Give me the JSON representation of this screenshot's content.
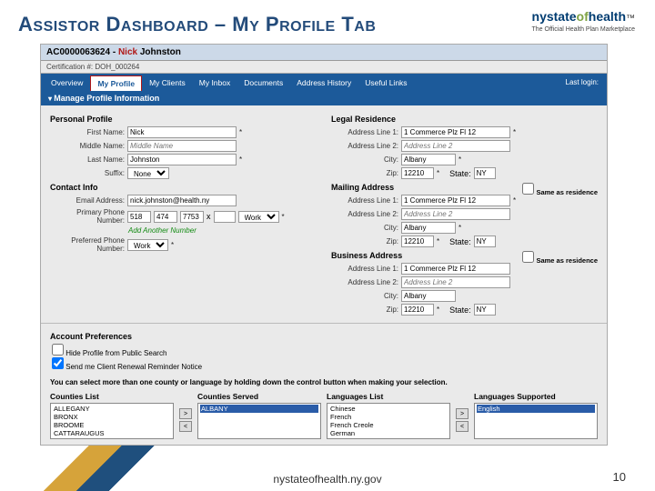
{
  "slide": {
    "title": "ASSISTOR DASHBOARD – MY PROFILE TAB",
    "footer": "nystateofhealth.ny.gov",
    "page": "10"
  },
  "branding": {
    "nys": "nystate",
    "of": "of",
    "health": "health",
    "sub": "The Official Health Plan Marketplace",
    "tm": "™"
  },
  "user": {
    "id": "AC0000063624",
    "sep": " - ",
    "first": "Nick",
    "last": "Johnston"
  },
  "subbar": "Certification #: DOH_000264",
  "tabs": [
    "Overview",
    "My Profile",
    "My Clients",
    "My Inbox",
    "Documents",
    "Address History",
    "Useful Links"
  ],
  "tabs_right": "Last login:",
  "section": "Manage Profile Information",
  "groups": {
    "personal": "Personal Profile",
    "contact": "Contact Info",
    "legal": "Legal Residence",
    "mailing": "Mailing Address",
    "business": "Business Address",
    "acct": "Account Preferences"
  },
  "labels": {
    "first": "First Name:",
    "middle": "Middle Name:",
    "last": "Last Name:",
    "suffix": "Suffix:",
    "email": "Email Address:",
    "pphone": "Primary Phone Number:",
    "prefphone": "Preferred Phone Number:",
    "a1": "Address Line 1:",
    "a2": "Address Line 2:",
    "city": "City:",
    "zip": "Zip:",
    "state": "State:",
    "same": "Same as residence"
  },
  "values": {
    "first": "Nick",
    "middle_ph": "Middle Name",
    "last": "Johnston",
    "suffix": "None",
    "email": "nick.johnston@health.ny",
    "phone1": "518",
    "phone2": "474",
    "phone3": "7753",
    "phonetype": "Work",
    "prefphone": "Work",
    "addr1": "1 Commerce Plz Fl 12",
    "addr2_ph": "Address Line 2",
    "city": "Albany",
    "zip": "12210",
    "state": "NY",
    "mail_a1": "1 Commerce Plz Fl 12",
    "mail_city": "Albany",
    "mail_zip": "12210",
    "mail_state": "NY",
    "bus_a1": "1 Commerce Plz Fl 12",
    "bus_city": "Albany",
    "bus_zip": "12210",
    "bus_state": "NY"
  },
  "addlink": "Add Another Number",
  "acct": {
    "opt1": "Hide Profile from Public Search",
    "opt2": "Send me Client Renewal Reminder Notice"
  },
  "hint": "You can select more than one county or language by holding down the control button when making your selection.",
  "lists": {
    "counties_list": "Counties List",
    "counties_served": "Counties Served",
    "languages_list": "Languages List",
    "languages_supported": "Languages Supported",
    "counties": [
      "ALLEGANY",
      "BRONX",
      "BROOME",
      "CATTARAUGUS"
    ],
    "counties_sel": "ALBANY",
    "langs": [
      "Chinese",
      "French",
      "French Creole",
      "German"
    ],
    "langs_sel": "English"
  }
}
